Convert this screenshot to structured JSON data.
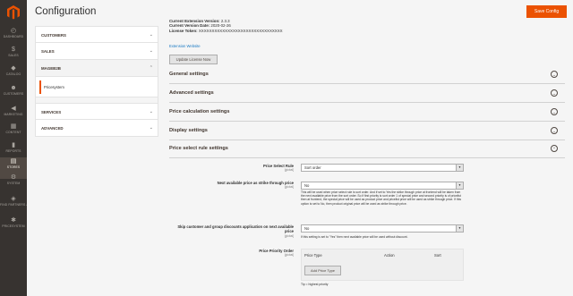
{
  "nav": {
    "items": [
      {
        "label": "DASHBOARD",
        "icon": "dashboard-icon",
        "glyph": "◴"
      },
      {
        "label": "SALES",
        "icon": "dollar-icon",
        "glyph": "$"
      },
      {
        "label": "CATALOG",
        "icon": "cube-icon",
        "glyph": "◆"
      },
      {
        "label": "CUSTOMERS",
        "icon": "person-icon",
        "glyph": "☻"
      },
      {
        "label": "MARKETING",
        "icon": "megaphone-icon",
        "glyph": "◀"
      },
      {
        "label": "CONTENT",
        "icon": "layout-icon",
        "glyph": "▦"
      },
      {
        "label": "REPORTS",
        "icon": "bar-chart-icon",
        "glyph": "▮"
      },
      {
        "label": "STORES",
        "icon": "store-icon",
        "glyph": "▤"
      },
      {
        "label": "SYSTEM",
        "icon": "gear-icon",
        "glyph": "⚙"
      },
      {
        "label": "FIND PARTNERS & EXTENSIONS",
        "icon": "puzzle-icon",
        "glyph": "◈"
      },
      {
        "label": "PRICESYSTEM",
        "icon": "pricesystem-icon",
        "glyph": "✱"
      }
    ]
  },
  "header": {
    "title": "Configuration",
    "save_label": "Save Config"
  },
  "config_tabs": {
    "customers": "CUSTOMERS",
    "sales": "SALES",
    "mageb2b": "MAGEB2B",
    "mageb2b_sub": "Pricesystem",
    "services": "SERVICES",
    "advanced": "ADVANCED"
  },
  "info": {
    "current_ext_label": "Current Extension Version:",
    "current_ext_value": "2.3.3",
    "version_date_label": "Current Version Date:",
    "version_date_value": "2020-02-26",
    "license_label": "License Token:",
    "license_value": "XXXXXXXXXXXXXXXXXXXXXXXXXXXXXXXX",
    "website_link": "Extension Website",
    "update_label": "Update License Now"
  },
  "sections": [
    "General settings",
    "Advanced settings",
    "Price calculation settings",
    "Display settings",
    "Price select rule settings"
  ],
  "fields": {
    "price_select_rule": {
      "label": "Price Select Rule",
      "scope": "[global]",
      "value": "Sort order"
    },
    "strike_through": {
      "label": "Next available price as strike through price",
      "scope": "[global]",
      "value": "No",
      "note": "This will be used when price select rule is sort order. And if set to Yes the strike through price at frontend will be taken from the next available price from the sort order. So if first priority is sort order 1 of special price and second priority is of pricelist then at frontend, the special price will be used as product price and pricelist price will be used as strike through price. If this option is set to No, then product original price will be used as strike through price."
    },
    "skip_discounts": {
      "label": "Skip customer and group discounts application on next available price",
      "scope": "[global]",
      "value": "No",
      "note": "If this setting is set to \"Yes\" then next available price will be used without discount."
    },
    "priority_order": {
      "label": "Price Priority Order",
      "scope": "[global]",
      "col_type": "Price Type",
      "col_action": "Action",
      "col_sort": "Sort",
      "add_label": "Add Price Type",
      "tip": "Tip = highest priority"
    }
  }
}
